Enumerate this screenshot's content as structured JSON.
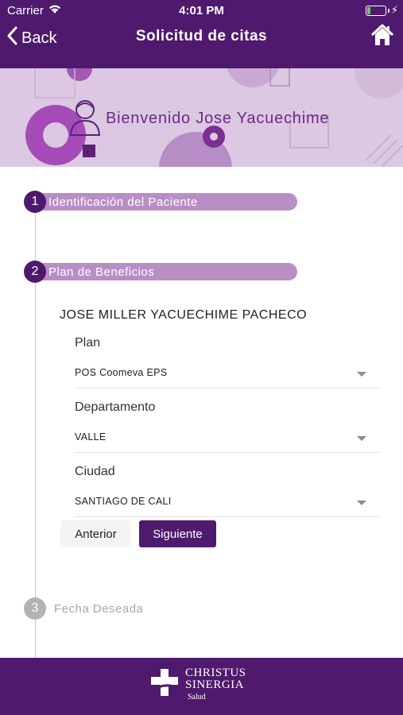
{
  "status_bar": {
    "carrier": "Carrier",
    "time": "4:01 PM",
    "battery_level": 0.2
  },
  "nav": {
    "back_label": "Back",
    "title": "Solicitud de citas",
    "home_icon": "home-icon"
  },
  "banner": {
    "welcome": "Bienvenido Jose Yacuechime",
    "avatar_icon": "user-avatar-icon"
  },
  "steps": [
    {
      "number": "1",
      "label": "Identificación del Paciente"
    },
    {
      "number": "2",
      "label": "Plan de Beneficios"
    },
    {
      "number": "3",
      "label": "Fecha Deseada"
    }
  ],
  "form": {
    "patient_name": "JOSE MILLER YACUECHIME PACHECO",
    "fields": [
      {
        "label": "Plan",
        "value": "POS Coomeva EPS"
      },
      {
        "label": "Departamento",
        "value": "VALLE"
      },
      {
        "label": "Ciudad",
        "value": "SANTIAGO DE CALI"
      }
    ],
    "prev_label": "Anterior",
    "next_label": "Siguiente"
  },
  "footer": {
    "logo_line1": "CHRISTUS",
    "logo_line2": "SINERGIA",
    "logo_line3": "Salud"
  },
  "colors": {
    "primary": "#4f1a6e",
    "step_bar": "#b98ec5",
    "banner_bg": "#dcc8e2",
    "inactive": "#b3b3b3"
  }
}
